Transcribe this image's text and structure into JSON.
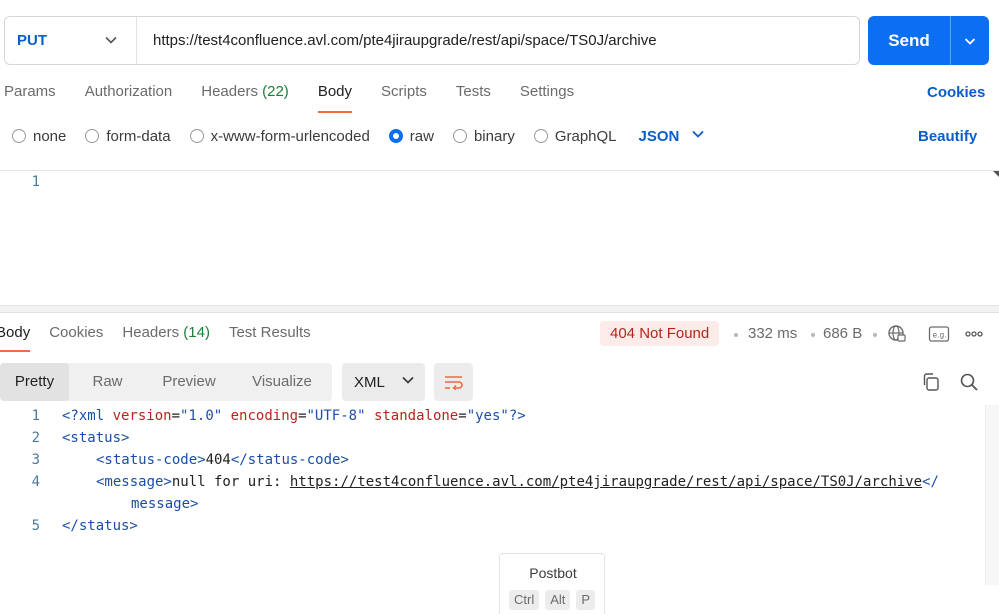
{
  "request": {
    "method": "PUT",
    "url": "https://test4confluence.avl.com/pte4jiraupgrade/rest/api/space/TS0J/archive",
    "send_label": "Send"
  },
  "request_tabs": {
    "params": "Params",
    "authorization": "Authorization",
    "headers": "Headers",
    "headers_count": "(22)",
    "body": "Body",
    "scripts": "Scripts",
    "tests": "Tests",
    "settings": "Settings",
    "active": "Body",
    "cookies": "Cookies"
  },
  "body_types": {
    "none": "none",
    "form_data": "form-data",
    "urlencoded": "x-www-form-urlencoded",
    "raw": "raw",
    "binary": "binary",
    "graphql": "GraphQL",
    "selected": "raw",
    "language": "JSON",
    "beautify": "Beautify"
  },
  "request_editor": {
    "line_number": "1"
  },
  "response_tabs": {
    "body": "Body",
    "cookies": "Cookies",
    "headers": "Headers",
    "headers_count": "(14)",
    "test_results": "Test Results",
    "active": "Body"
  },
  "response_meta": {
    "status": "404 Not Found",
    "time": "332 ms",
    "size": "686 B"
  },
  "response_view": {
    "pretty": "Pretty",
    "raw": "Raw",
    "preview": "Preview",
    "visualize": "Visualize",
    "active": "Pretty",
    "format": "XML"
  },
  "response_code": {
    "lines": [
      {
        "n": "1"
      },
      {
        "n": "2"
      },
      {
        "n": "3"
      },
      {
        "n": "4"
      },
      {
        "n": "5"
      }
    ],
    "l1": {
      "open": "<?xml ",
      "attr1": "version",
      "eq1": "=",
      "val1": "\"1.0\"",
      "attr2": "encoding",
      "eq2": "=",
      "val2": "\"UTF-8\"",
      "attr3": "standalone",
      "eq3": "=",
      "val3": "\"yes\"",
      "close": "?>"
    },
    "l2": "<status>",
    "l3": {
      "open": "<status-code>",
      "value": "404",
      "close": "</status-code>"
    },
    "l4": {
      "open": "<message>",
      "text": "null for uri: ",
      "url": "https://test4confluence.avl.com/pte4jiraupgrade/rest/api/space/TS0J/archive",
      "close_start": "</",
      "close_end": "message>"
    },
    "l5": "</status>"
  },
  "postbot": {
    "title": "Postbot",
    "keys": [
      "Ctrl",
      "Alt",
      "P"
    ]
  },
  "colors": {
    "accent": "#0c6ef0",
    "tab_underline": "#f26b3a",
    "error_bg": "#fdebe9",
    "error_text": "#b3261e",
    "count_green": "#1a7f37"
  }
}
